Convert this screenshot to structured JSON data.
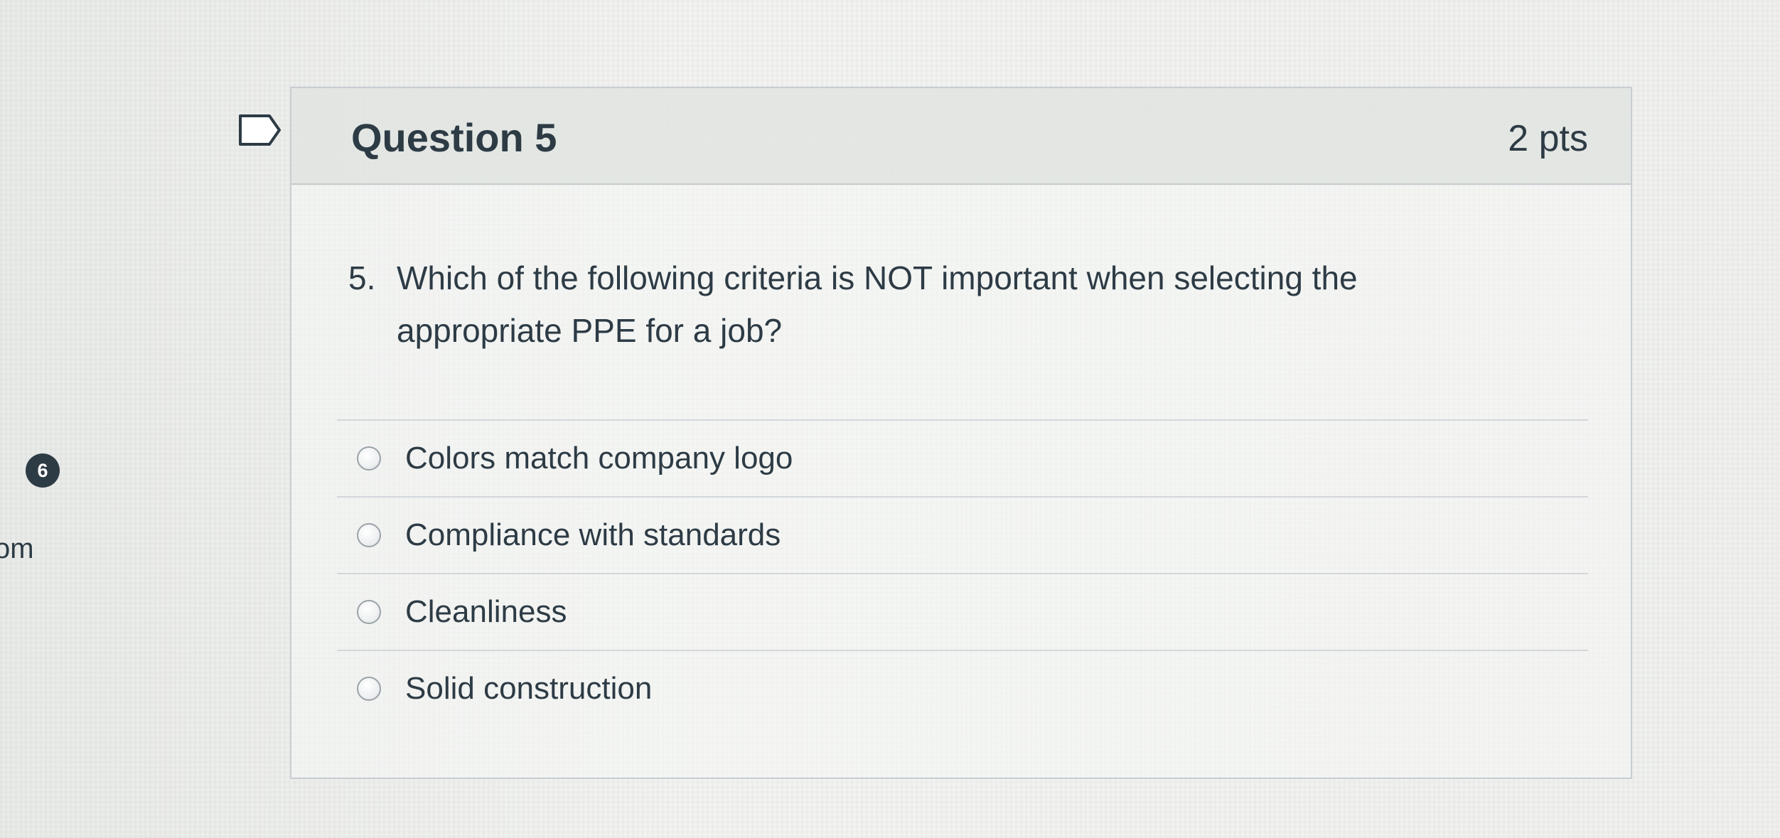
{
  "sidebar": {
    "badge_count": "6",
    "edge_text": "om"
  },
  "question": {
    "title": "Question 5",
    "points": "2 pts",
    "number": "5.",
    "text": "Which of the following criteria is NOT important when selecting the appropriate PPE for a job?"
  },
  "answers": [
    {
      "label": "Colors match company logo",
      "selected": false
    },
    {
      "label": "Compliance with standards",
      "selected": false
    },
    {
      "label": "Cleanliness",
      "selected": false
    },
    {
      "label": "Solid construction",
      "selected": false
    }
  ],
  "icons": {
    "flag": "bookmark-flag-icon",
    "radio": "radio-button-icon"
  },
  "colors": {
    "text": "#2d3b45",
    "header_bg": "#dee1de",
    "border": "#c8cdd0"
  }
}
